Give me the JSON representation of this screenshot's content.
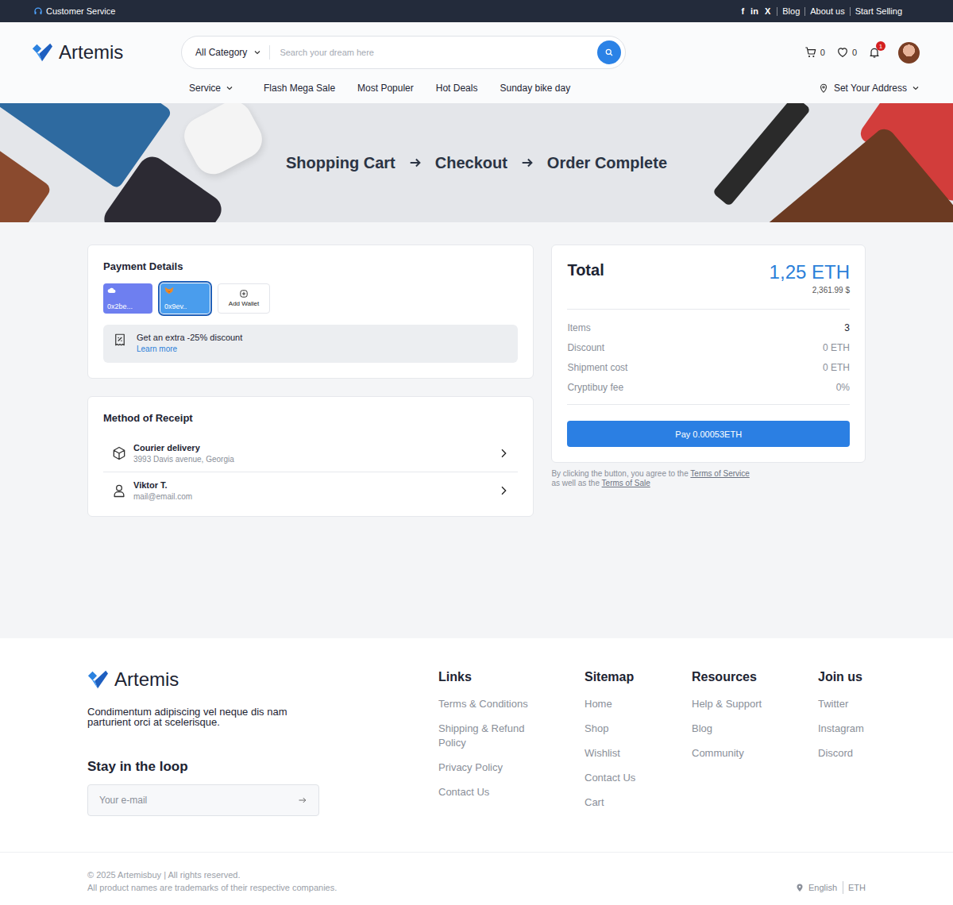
{
  "topbar": {
    "service": "Customer Service",
    "socials": [
      "f",
      "in",
      "X"
    ],
    "links": [
      "Blog",
      "About us",
      "Start Selling"
    ]
  },
  "header": {
    "logo": "Artemis",
    "category": "All Category",
    "search_placeholder": "Search your dream here",
    "cart_count": "0",
    "wishlist_count": "0",
    "notification_badge": "1"
  },
  "nav": {
    "items": [
      {
        "label": "Service",
        "has_menu": true
      },
      {
        "label": "Flash Mega Sale",
        "has_menu": false
      },
      {
        "label": "Most Populer",
        "has_menu": false
      },
      {
        "label": "Hot Deals",
        "has_menu": false
      },
      {
        "label": "Sunday bike day",
        "has_menu": false
      }
    ],
    "address": "Set Your Address"
  },
  "steps": [
    "Shopping Cart",
    "Checkout",
    "Order Complete"
  ],
  "payment": {
    "title": "Payment Details",
    "wallets": [
      {
        "label": "0x2be...",
        "kind": "cloud",
        "color": "#6e7ff0",
        "selected": false
      },
      {
        "label": "0x9ev..",
        "kind": "fox",
        "color": "#4a9ded",
        "selected": true
      }
    ],
    "add_wallet": "Add Wallet",
    "promo": {
      "text": "Get an extra -25% discount",
      "link": "Learn more"
    }
  },
  "receipt": {
    "title": "Method of Receipt",
    "options": [
      {
        "kind": "delivery",
        "title": "Courier delivery",
        "subtitle": "3993 Davis avenue, Georgia"
      },
      {
        "kind": "contact",
        "title": "Viktor T.",
        "subtitle": "mail@email.com"
      }
    ]
  },
  "total": {
    "title": "Total",
    "amount": "1,25 ETH",
    "fiat": "2,361.99 $",
    "rows": [
      {
        "label": "Items",
        "value": "3"
      },
      {
        "label": "Discount",
        "value": "0 ETH"
      },
      {
        "label": "Shipment cost",
        "value": "0 ETH"
      },
      {
        "label": "Cryptibuy fee",
        "value": "0%"
      }
    ],
    "pay_button": "Pay 0.00053ETH"
  },
  "terms": {
    "prefix": "By clicking the button, you agree to the",
    "service_link": "Terms of Service",
    "middle": "as well as the",
    "sale_link": "Terms of Sale"
  },
  "footer": {
    "logo": "Artemis",
    "description": "Condimentum adipiscing vel neque dis nam parturient orci at scelerisque.",
    "newsletter_title": "Stay in the loop",
    "email_placeholder": "Your e-mail",
    "columns": [
      {
        "title": "Links",
        "items": [
          "Terms & Conditions",
          "Shipping & Refund Policy",
          "Privacy Policy",
          "Contact Us"
        ]
      },
      {
        "title": "Sitemap",
        "items": [
          "Home",
          "Shop",
          "Wishlist",
          "Contact Us",
          "Cart"
        ]
      },
      {
        "title": "Resources",
        "items": [
          "Help & Support",
          "Blog",
          "Community"
        ]
      },
      {
        "title": "Join us",
        "items": [
          "Twitter",
          "Instagram",
          "Discord"
        ]
      }
    ],
    "copyright": "© 2025 Artemisbuy | All rights reserved.",
    "trademark": "All product names are trademarks of their respective companies.",
    "language": "English",
    "currency": "ETH"
  }
}
